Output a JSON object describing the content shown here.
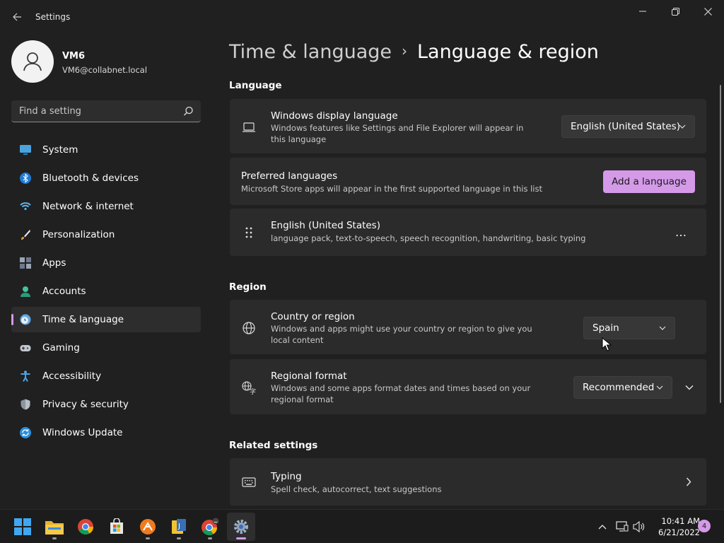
{
  "window": {
    "title": "Settings",
    "back_label": "Back",
    "controls": {
      "minimize": "minimize-icon",
      "maximize": "restore-icon",
      "close": "close-icon"
    }
  },
  "profile": {
    "name": "VM6",
    "email": "VM6@collabnet.local"
  },
  "search": {
    "placeholder": "Find a setting"
  },
  "sidebar": {
    "items": [
      {
        "label": "System",
        "icon": "system-icon"
      },
      {
        "label": "Bluetooth & devices",
        "icon": "bluetooth-icon"
      },
      {
        "label": "Network & internet",
        "icon": "wifi-icon"
      },
      {
        "label": "Personalization",
        "icon": "brush-icon"
      },
      {
        "label": "Apps",
        "icon": "apps-icon"
      },
      {
        "label": "Accounts",
        "icon": "accounts-icon"
      },
      {
        "label": "Time & language",
        "icon": "time-language-icon",
        "active": true
      },
      {
        "label": "Gaming",
        "icon": "gamepad-icon"
      },
      {
        "label": "Accessibility",
        "icon": "accessibility-icon"
      },
      {
        "label": "Privacy & security",
        "icon": "shield-icon"
      },
      {
        "label": "Windows Update",
        "icon": "update-icon"
      }
    ]
  },
  "breadcrumb": {
    "parent": "Time & language",
    "separator": "›",
    "current": "Language & region"
  },
  "language_section": {
    "title": "Language",
    "display_language": {
      "title": "Windows display language",
      "description": "Windows features like Settings and File Explorer will appear in this language",
      "value": "English (United States)"
    },
    "preferred": {
      "title": "Preferred languages",
      "description": "Microsoft Store apps will appear in the first supported language in this list",
      "button": "Add a language"
    },
    "installed": {
      "title": "English (United States)",
      "description": "language pack, text-to-speech, speech recognition, handwriting, basic typing",
      "more": "…"
    }
  },
  "region_section": {
    "title": "Region",
    "country": {
      "title": "Country or region",
      "description": "Windows and apps might use your country or region to give you local content",
      "value": "Spain"
    },
    "format": {
      "title": "Regional format",
      "description": "Windows and some apps format dates and times based on your regional format",
      "value": "Recommended"
    }
  },
  "related_section": {
    "title": "Related settings",
    "typing": {
      "title": "Typing",
      "description": "Spell check, autocorrect, text suggestions"
    }
  },
  "taskbar": {
    "apps": [
      "start",
      "file-explorer",
      "chrome",
      "microsoft-store",
      "app-orange",
      "app-yellow",
      "chrome-profile",
      "settings"
    ],
    "clock": {
      "time": "10:41 AM",
      "date": "6/21/2022"
    },
    "notifications": "4"
  },
  "colors": {
    "accent": "#d49ae8",
    "background": "#202020",
    "card": "#2b2b2b"
  }
}
